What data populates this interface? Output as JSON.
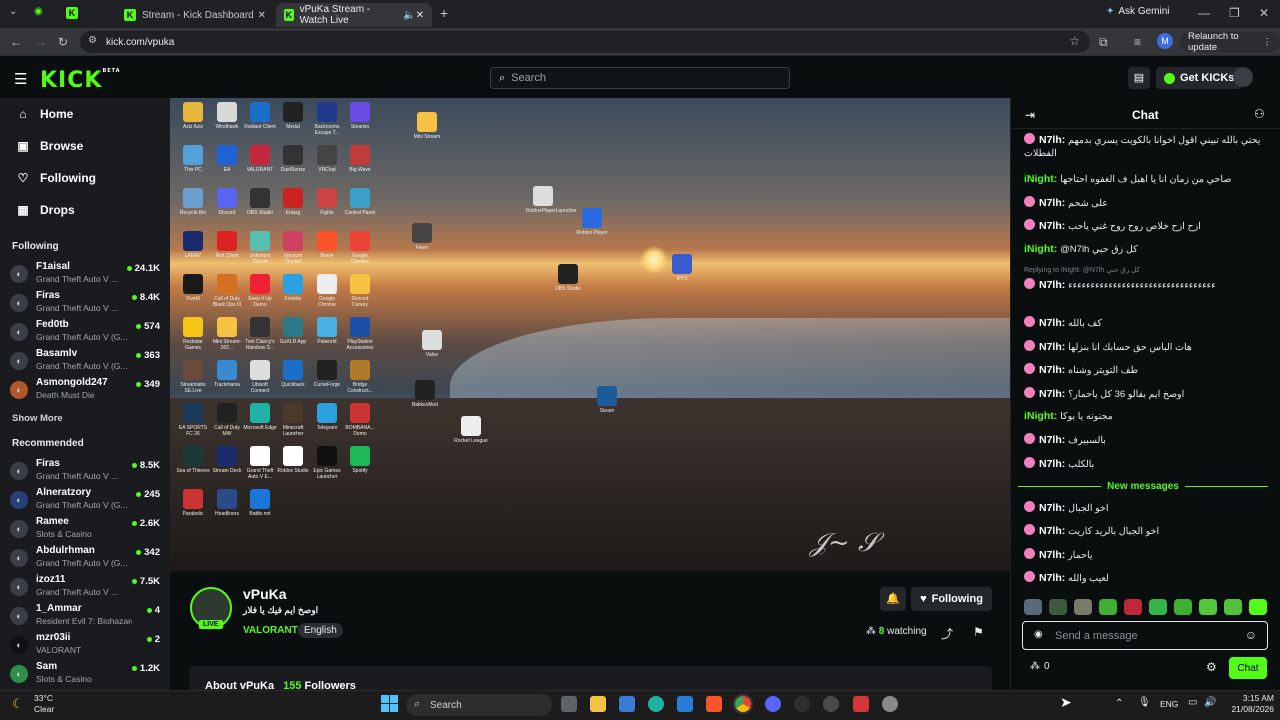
{
  "browser": {
    "tabs": [
      {
        "label": "Stream - Kick Dashboard"
      },
      {
        "label": "vPuKa Stream - Watch Live"
      }
    ],
    "ask_gemini": "Ask Gemini",
    "url": "kick.com/vpuka",
    "profile_initial": "M",
    "relaunch": "Relaunch to update"
  },
  "header": {
    "logo": "KICK",
    "logo_sup": "BETA",
    "search_placeholder": "Search",
    "get_kicks": "Get KICKs"
  },
  "sidebar": {
    "nav": [
      {
        "label": "Home",
        "icon": "home-icon"
      },
      {
        "label": "Browse",
        "icon": "browse-icon"
      },
      {
        "label": "Following",
        "icon": "heart-icon"
      },
      {
        "label": "Drops",
        "icon": "drops-icon"
      }
    ],
    "following_heading": "Following",
    "following": [
      {
        "name": "F1aisal",
        "game": "Grand Theft Auto V ...",
        "viewers": "24.1K"
      },
      {
        "name": "Firas",
        "game": "Grand Theft Auto V ...",
        "viewers": "8.4K"
      },
      {
        "name": "Fed0tb",
        "game": "Grand Theft Auto V (G...",
        "viewers": "574"
      },
      {
        "name": "Basamlv",
        "game": "Grand Theft Auto V (G...",
        "viewers": "363"
      },
      {
        "name": "Asmongold247",
        "game": "Death Must Die",
        "viewers": "349"
      }
    ],
    "show_more": "Show More",
    "recommended_heading": "Recommended",
    "recommended": [
      {
        "name": "Firas",
        "game": "Grand Theft Auto V ...",
        "viewers": "8.5K"
      },
      {
        "name": "Alneratzory",
        "game": "Grand Theft Auto V (G...",
        "viewers": "245"
      },
      {
        "name": "Ramee",
        "game": "Slots & Casino",
        "viewers": "2.6K"
      },
      {
        "name": "Abdulrhman",
        "game": "Grand Theft Auto V (G...",
        "viewers": "342"
      },
      {
        "name": "izoz11",
        "game": "Grand Theft Auto V ...",
        "viewers": "7.5K"
      },
      {
        "name": "1_Ammar",
        "game": "Resident Evil 7: Biohazard",
        "viewers": "4"
      },
      {
        "name": "mzr03ii",
        "game": "VALORANT",
        "viewers": "2"
      },
      {
        "name": "Sam",
        "game": "Slots & Casino",
        "viewers": "1.2K"
      }
    ]
  },
  "desktop_icons": [
    "Aziz Aziz",
    "Windhawk",
    "Radiant Client",
    "Medal",
    "Backrooms Escape T...",
    "Steamio",
    "This PC",
    "EA",
    "VALORANT",
    "DuelSense",
    "VRChat",
    "Big Wave",
    "Recycle Bin",
    "Discord",
    "OBS Studio",
    "Enlarg",
    "Fights",
    "Control Panel",
    "LAMAZ",
    "Riot Client",
    "Unlimited Chunk",
    "Upcount Trackel",
    "Brave",
    "Google Chrome",
    "FiveM",
    "Call of Duty Black Ops III",
    "Keep it Up Demo",
    "Fortnite",
    "Google Chrome",
    "Discord Canary",
    "Rockstar Games",
    "Mini Stream-202...",
    "Tom Clancy's Rainbow S...",
    "GoXLR App",
    "Palworld",
    "PlayStation Accessories",
    "Streamlabs SE.Live",
    "Trackmania",
    "Ubisoft Connect",
    "Quickback",
    "CurseForge",
    "Bridge Construct...",
    "EA SPORTS FC 26",
    "Call of Duty MW",
    "Microsoft Edge",
    "Minecraft Launcher",
    "Telegram",
    "BOMBANA... Demo",
    "Sea of Thieves",
    "Stream Deck",
    "Grand Theft Auto V E...",
    "Roblox Studio",
    "Epic Games Launcher",
    "Spotify",
    "Parabolic",
    "Headliners",
    "Battle.net"
  ],
  "desktop_center_icons": [
    "Mini Stream",
    "RobloxPlayerLauncher",
    "Roblox Player",
    "OBS Studio",
    "IPTV",
    "Fiverr",
    "Valve",
    "Steam",
    "BakkesMod",
    "Rocket League"
  ],
  "stream": {
    "name": "vPuKa",
    "title": "اوصخ ايم فيك يا فلار",
    "category": "VALORANT",
    "tag": "English",
    "live": "LIVE",
    "follow_label": "Following",
    "watching_count": "8",
    "watching_label": "watching",
    "about_prefix": "About vPuKa",
    "followers": "155",
    "followers_label": "Followers"
  },
  "chat": {
    "title": "Chat",
    "messages": [
      {
        "user": "N7lh",
        "color": "#53fc18",
        "badge": true,
        "text": "يحتي بالله تبيني اقول اخوانا بالكويت يسري بدمهم الفطلات"
      },
      {
        "user": "iNight",
        "color": "#53fc18",
        "badge": false,
        "text": "صاحي من زمان انا يا اهبل ف الغفوه احتاجها"
      },
      {
        "user": "N7lh",
        "color": "#53fc18",
        "badge": true,
        "text": "على شحم"
      },
      {
        "user": "N7lh",
        "color": "#53fc18",
        "badge": true,
        "text": "ازح ازح خلاص روح روح غني ياحب"
      },
      {
        "user": "iNight",
        "color": "#53fc18",
        "badge": false,
        "text": "@N7lh كل زق حبي"
      },
      {
        "user": "N7lh",
        "color": "#53fc18",
        "badge": true,
        "text": "ءءءءءءءءءءءءءءءءءءءءءءءءءءءءءءءءء"
      },
      {
        "user": "N7lh",
        "color": "#53fc18",
        "badge": true,
        "text": "كف بالله"
      },
      {
        "user": "N7lh",
        "color": "#53fc18",
        "badge": true,
        "text": "هات الباس حق حسابك انا بنزلها"
      },
      {
        "user": "N7lh",
        "color": "#53fc18",
        "badge": true,
        "text": "طف التويتر وشناه"
      },
      {
        "user": "N7lh",
        "color": "#53fc18",
        "badge": true,
        "text": "اوصخ ايم بفالو 36 كل ياحمار؟"
      },
      {
        "user": "iNight",
        "color": "#53fc18",
        "badge": false,
        "text": "مجنونه يا بوكا"
      },
      {
        "user": "N7lh",
        "color": "#53fc18",
        "badge": true,
        "text": "بالسبيرف"
      },
      {
        "user": "N7lh",
        "color": "#53fc18",
        "badge": true,
        "text": "بالكلب"
      },
      {
        "user": "N7lh",
        "color": "#53fc18",
        "badge": true,
        "text": "اخو الجبال"
      },
      {
        "user": "N7lh",
        "color": "#53fc18",
        "badge": true,
        "text": "اخو الجبال بالريد كاريت"
      },
      {
        "user": "N7lh",
        "color": "#53fc18",
        "badge": true,
        "text": "ياحمار"
      },
      {
        "user": "N7lh",
        "color": "#53fc18",
        "badge": true,
        "text": "لعيب والله"
      }
    ],
    "reply_note": "Replying to iNight: @N7lh كل زق حبي",
    "new_messages": "New messages",
    "input_placeholder": "Send a message",
    "points": "0",
    "send_label": "Chat"
  },
  "taskbar": {
    "weather_temp": "33°C",
    "weather_desc": "Clear",
    "search": "Search",
    "lang": "ENG",
    "time": "3:15 AM",
    "date": "21/08/2026"
  }
}
